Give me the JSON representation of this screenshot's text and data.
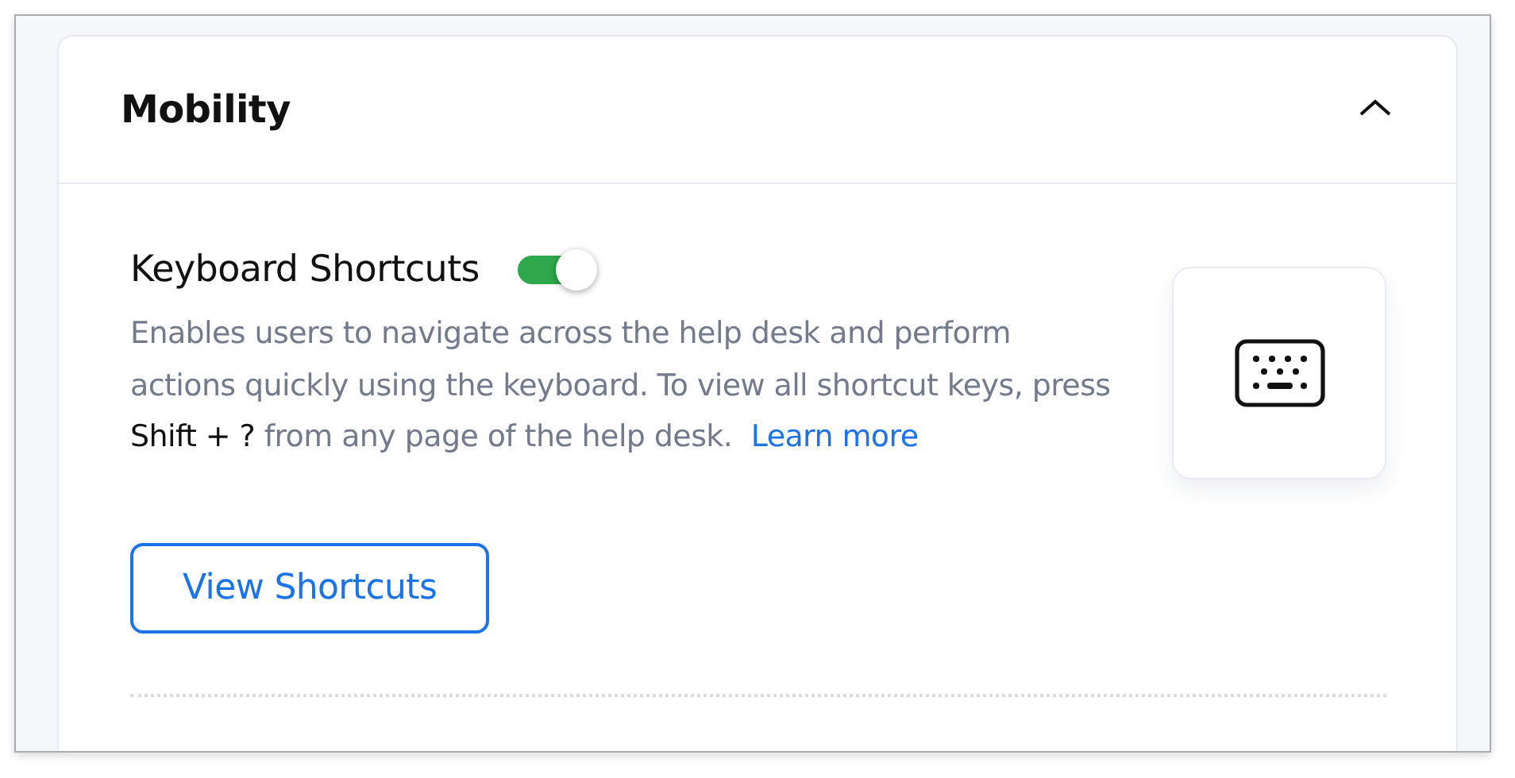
{
  "section": {
    "title": "Mobility",
    "expanded": true
  },
  "setting": {
    "title": "Keyboard Shortcuts",
    "on": true,
    "description": {
      "before": "Enables users to navigate across the help desk and perform actions quickly using the keyboard. To view all shortcut keys, press ",
      "keys": "Shift + ?",
      "after": " from any page of the help desk."
    },
    "link": "Learn more",
    "button": "View Shortcuts"
  }
}
